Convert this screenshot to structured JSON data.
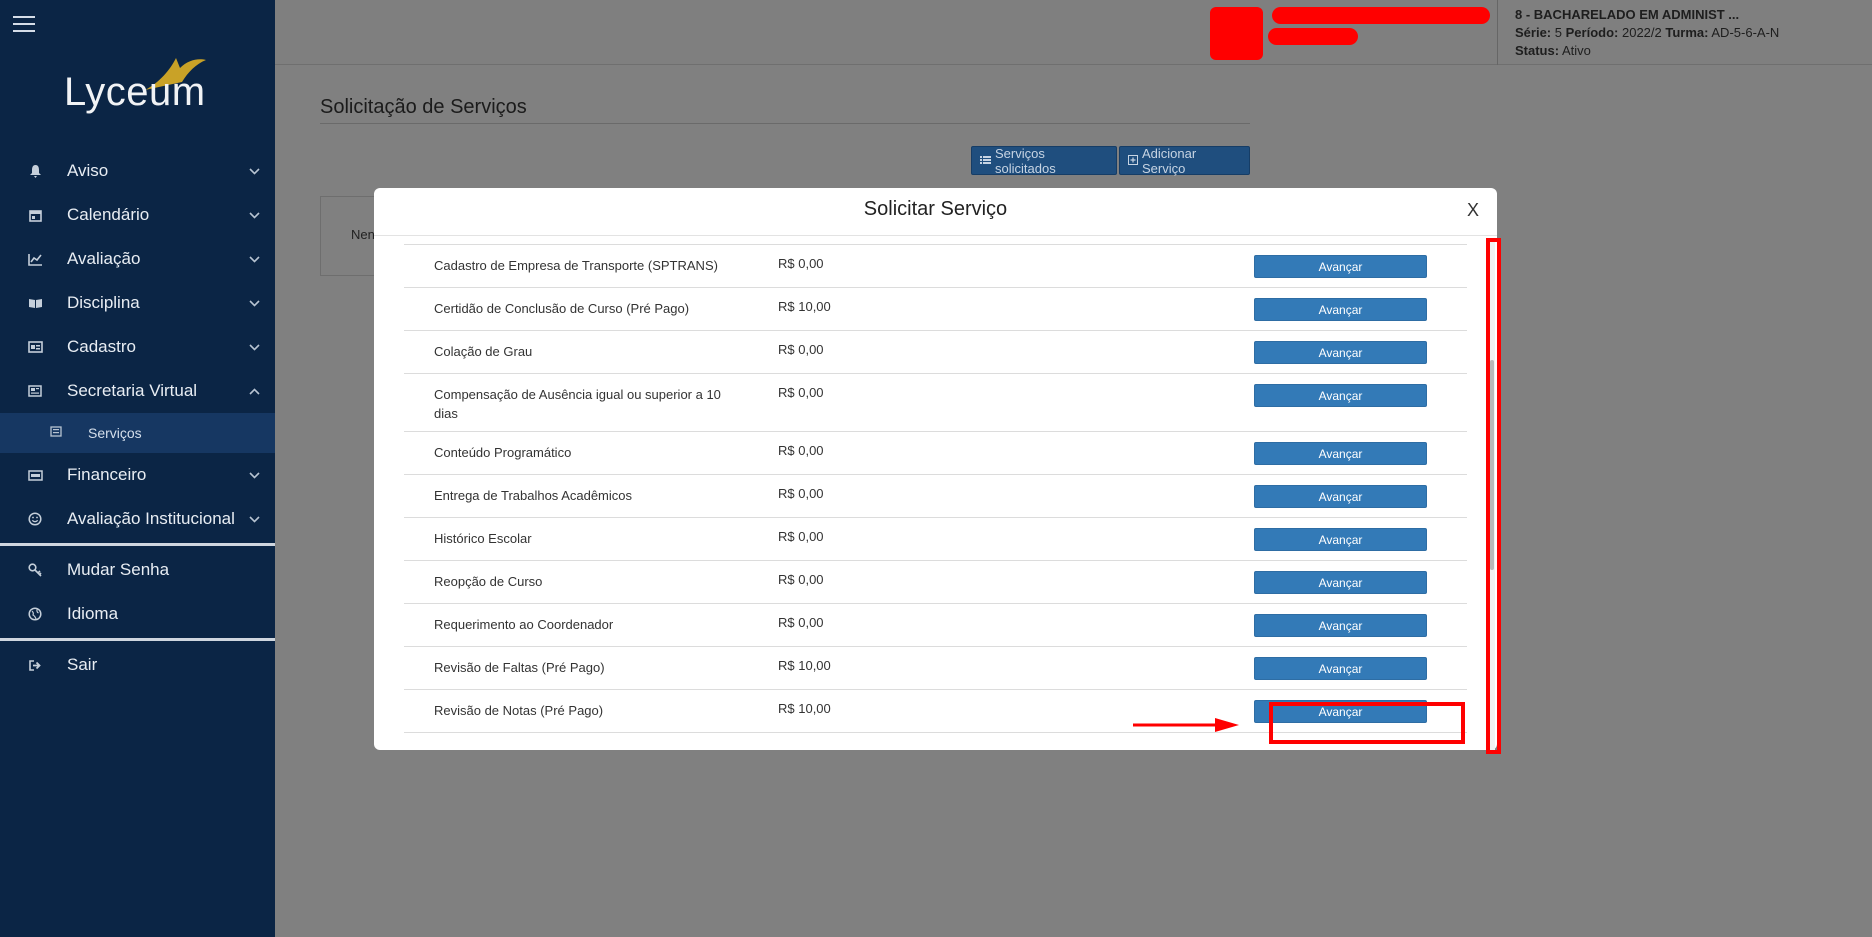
{
  "sidebar": {
    "logo_text": "Lyceum",
    "items": [
      {
        "label": "Aviso",
        "icon": "bell-icon"
      },
      {
        "label": "Calendário",
        "icon": "calendar-icon"
      },
      {
        "label": "Avaliação",
        "icon": "chart-line-icon"
      },
      {
        "label": "Disciplina",
        "icon": "book-icon"
      },
      {
        "label": "Cadastro",
        "icon": "id-card-icon"
      },
      {
        "label": "Secretaria Virtual",
        "icon": "newspaper-icon"
      }
    ],
    "submenu": {
      "label": "Serviços",
      "icon": "newspaper-icon"
    },
    "items2": [
      {
        "label": "Financeiro",
        "icon": "money-icon"
      },
      {
        "label": "Avaliação Institucional",
        "icon": "smile-icon"
      }
    ],
    "items3": [
      {
        "label": "Mudar Senha",
        "icon": "key-icon"
      },
      {
        "label": "Idioma",
        "icon": "globe-icon"
      }
    ],
    "items4": [
      {
        "label": "Sair",
        "icon": "sign-out-icon"
      }
    ]
  },
  "topbar": {
    "course": "8 - BACHARELADO EM ADMINIST ...",
    "serie_label": "Série:",
    "serie_value": "5",
    "periodo_label": "Período:",
    "periodo_value": "2022/2",
    "turma_label": "Turma:",
    "turma_value": "AD-5-6-A-N",
    "status_label": "Status:",
    "status_value": "Ativo"
  },
  "page": {
    "title": "Solicitação de Serviços",
    "btn_solicitados": "Serviços solicitados",
    "btn_adicionar": "Adicionar Serviço",
    "bg_text": "Nen"
  },
  "modal": {
    "title": "Solicitar Serviço",
    "close": "X",
    "button_label": "Avançar",
    "services": [
      {
        "name": "Cadastro de Empresa de Transporte (SPTRANS)",
        "price": "R$ 0,00"
      },
      {
        "name": "Certidão de Conclusão de Curso (Pré Pago)",
        "price": "R$ 10,00"
      },
      {
        "name": "Colação de Grau",
        "price": "R$ 0,00"
      },
      {
        "name": "Compensação de Ausência igual ou superior a 10 dias",
        "price": "R$ 0,00"
      },
      {
        "name": "Conteúdo Programático",
        "price": "R$ 0,00"
      },
      {
        "name": "Entrega de Trabalhos Acadêmicos",
        "price": "R$ 0,00"
      },
      {
        "name": "Histórico Escolar",
        "price": "R$ 0,00"
      },
      {
        "name": "Reopção de Curso",
        "price": "R$ 0,00"
      },
      {
        "name": "Requerimento ao Coordenador",
        "price": "R$ 0,00"
      },
      {
        "name": "Revisão de Faltas (Pré Pago)",
        "price": "R$ 10,00"
      },
      {
        "name": "Revisão de Notas (Pré Pago)",
        "price": "R$ 10,00"
      }
    ]
  },
  "colors": {
    "sidebar_bg": "#0b2545",
    "button_blue": "#337ab7",
    "annotation_red": "#ff0000"
  }
}
